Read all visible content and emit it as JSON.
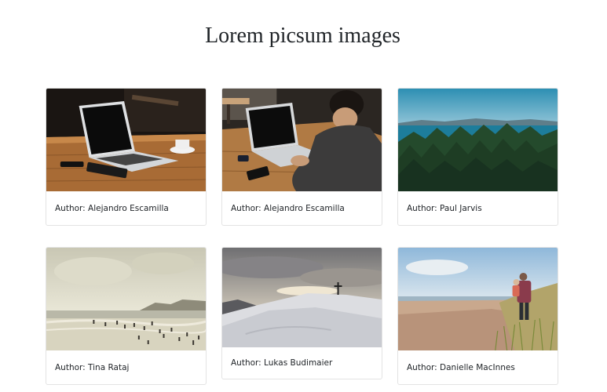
{
  "page": {
    "title": "Lorem picsum images"
  },
  "cards": [
    {
      "author_label": "Author: Alejandro Escamilla",
      "image": "laptop-on-wooden-table-photo"
    },
    {
      "author_label": "Author: Alejandro Escamilla",
      "image": "person-typing-on-laptop-photo"
    },
    {
      "author_label": "Author: Paul Jarvis",
      "image": "forest-and-lake-photo"
    },
    {
      "author_label": "Author: Tina Rataj",
      "image": "beach-with-people-photo"
    },
    {
      "author_label": "Author: Lukas Budimaier",
      "image": "snowy-hill-with-cross-photo"
    },
    {
      "author_label": "Author: Danielle MacInnes",
      "image": "man-carrying-child-on-beach-photo"
    }
  ]
}
